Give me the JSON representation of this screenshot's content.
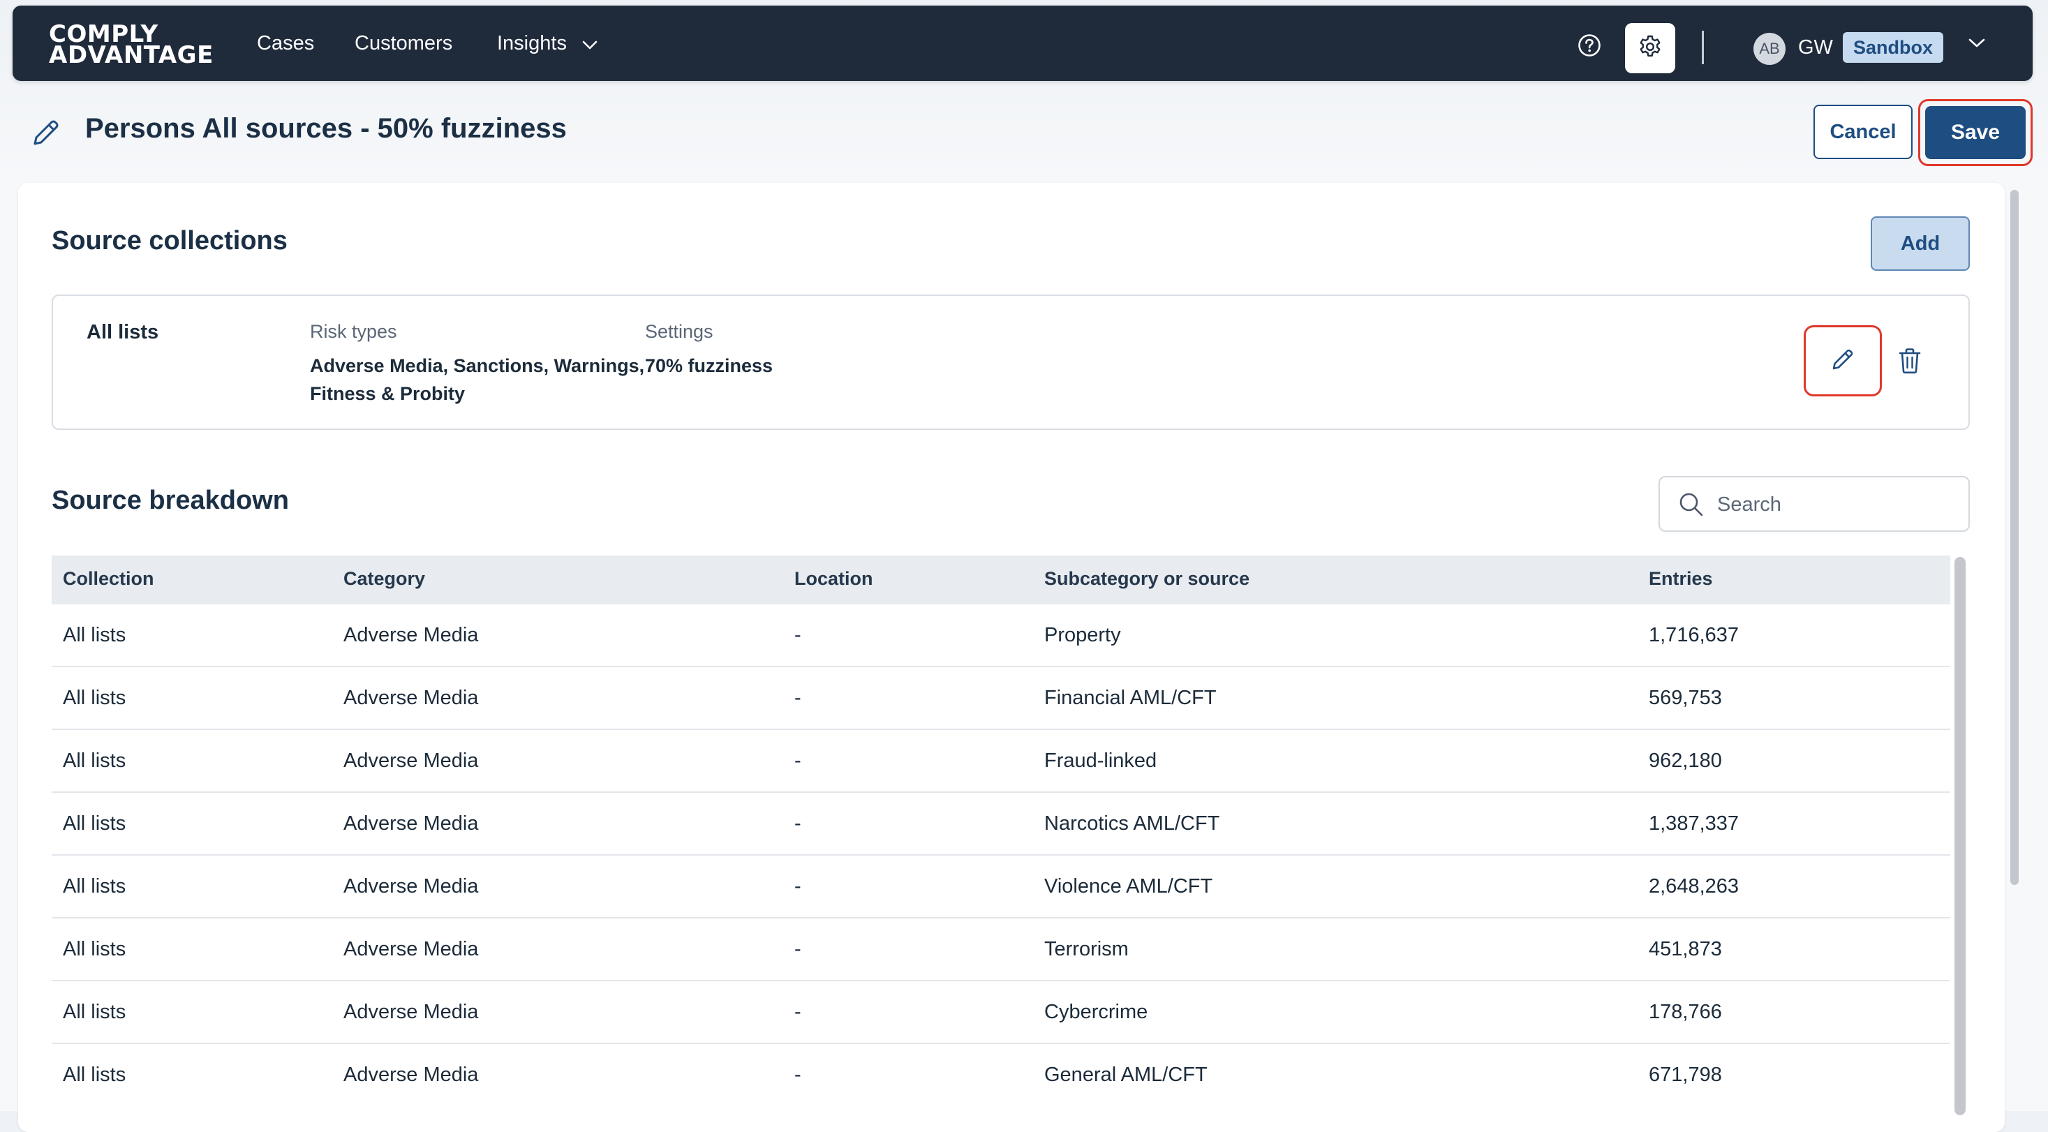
{
  "nav": {
    "logo_line1": "COMPLY",
    "logo_line2": "ADVANTAGE",
    "links": [
      "Cases",
      "Customers",
      "Insights"
    ],
    "avatar_initials": "AB",
    "user_initials": "GW",
    "environment": "Sandbox"
  },
  "header": {
    "title": "Persons All sources - 50% fuzziness",
    "cancel_label": "Cancel",
    "save_label": "Save"
  },
  "source_collections": {
    "title": "Source collections",
    "add_label": "Add",
    "items": [
      {
        "name": "All lists",
        "risk_types_label": "Risk types",
        "risk_types_line1": "Adverse Media, Sanctions, Warnings,",
        "risk_types_line2": "Fitness & Probity",
        "settings_label": "Settings",
        "settings_value": "70% fuzziness"
      }
    ]
  },
  "source_breakdown": {
    "title": "Source breakdown",
    "search_placeholder": "Search",
    "columns": [
      "Collection",
      "Category",
      "Location",
      "Subcategory or source",
      "Entries"
    ],
    "rows": [
      [
        "All lists",
        "Adverse Media",
        "-",
        "Property",
        "1,716,637"
      ],
      [
        "All lists",
        "Adverse Media",
        "-",
        "Financial AML/CFT",
        "569,753"
      ],
      [
        "All lists",
        "Adverse Media",
        "-",
        "Fraud-linked",
        "962,180"
      ],
      [
        "All lists",
        "Adverse Media",
        "-",
        "Narcotics AML/CFT",
        "1,387,337"
      ],
      [
        "All lists",
        "Adverse Media",
        "-",
        "Violence AML/CFT",
        "2,648,263"
      ],
      [
        "All lists",
        "Adverse Media",
        "-",
        "Terrorism",
        "451,873"
      ],
      [
        "All lists",
        "Adverse Media",
        "-",
        "Cybercrime",
        "178,766"
      ],
      [
        "All lists",
        "Adverse Media",
        "-",
        "General AML/CFT",
        "671,798"
      ]
    ]
  },
  "colors": {
    "navbar": "#1f2a3b",
    "primary": "#1e4d82",
    "highlight": "#e0382a"
  }
}
